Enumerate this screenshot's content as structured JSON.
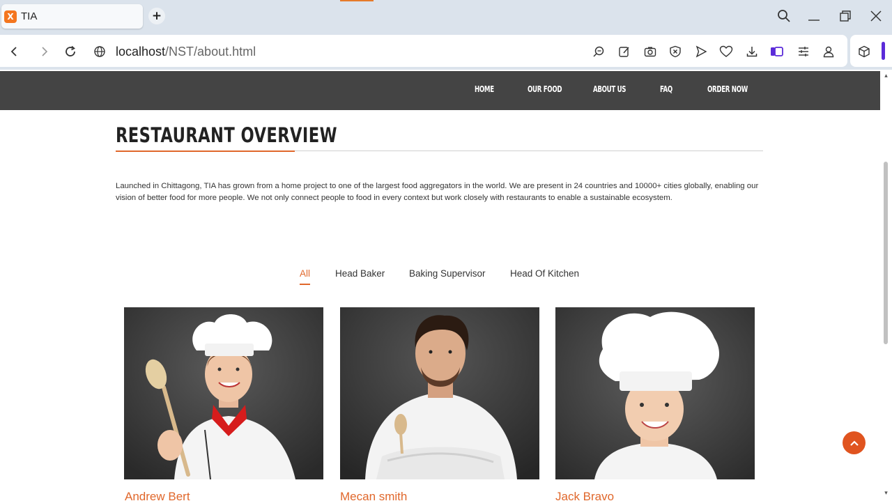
{
  "browser": {
    "tab_title": "TIA",
    "favicon_letter": "X",
    "url_host": "localhost",
    "url_path": "/NST/about.html",
    "toolbar_icons": [
      "zoom-icon",
      "edit-icon",
      "camera-icon",
      "shield-icon",
      "send-icon",
      "heart-icon",
      "download-icon",
      "sidebar-icon",
      "settings-icon",
      "profile-icon",
      "extensions-icon"
    ]
  },
  "nav": {
    "items": [
      "HOME",
      "OUR FOOD",
      "ABOUT US",
      "FAQ",
      "ORDER NOW"
    ]
  },
  "overview": {
    "title": "RESTAURANT OVERVIEW",
    "text": "Launched in Chittagong, TIA has grown from a home project to one of the largest food aggregators in the world. We are present in 24 countries and 10000+ cities globally, enabling our vision of better food for more people. We not only connect people to food in every context but work closely with restaurants to enable a sustainable ecosystem."
  },
  "filters": {
    "items": [
      "All",
      "Head Baker",
      "Baking Supervisor",
      "Head Of Kitchen"
    ],
    "active": "All"
  },
  "team": [
    {
      "name": "Andrew Bert"
    },
    {
      "name": "Mecan smith"
    },
    {
      "name": "Jack Bravo"
    }
  ],
  "colors": {
    "accent": "#e0672b",
    "nav_bg": "#444444",
    "back_to_top": "#e0541f"
  }
}
